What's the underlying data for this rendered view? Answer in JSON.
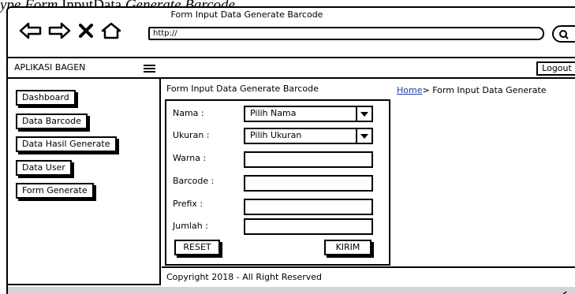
{
  "caption": {
    "prefix": "ype Form",
    "main": "InputData",
    "suffix": "Generate Barcode"
  },
  "browser": {
    "window_title": "Form Input Data Generate Barcode",
    "url": "http://",
    "nav_icons": [
      "back-arrow-icon",
      "forward-arrow-icon",
      "close-x-icon",
      "home-icon"
    ],
    "search_icon": "search-icon"
  },
  "app": {
    "title": "APLIKASI BAGEN",
    "menu_icon": "hamburger-menu-icon",
    "logout_label": "Logout"
  },
  "sidebar": {
    "items": [
      {
        "label": "Dashboard"
      },
      {
        "label": "Data Barcode"
      },
      {
        "label": "Data Hasil Generate"
      },
      {
        "label": "Data User"
      },
      {
        "label": "Form Generate"
      }
    ]
  },
  "content": {
    "header": "Form Input Data Generate Barcode",
    "breadcrumb": {
      "home": "Home",
      "separator": ">",
      "current": "Form Input Data Generate"
    }
  },
  "form": {
    "nama": {
      "label": "Nama :",
      "value": "Pilih Nama"
    },
    "ukuran": {
      "label": "Ukuran :",
      "value": "Pilih Ukuran"
    },
    "warna": {
      "label": "Warna :",
      "value": ""
    },
    "barcode": {
      "label": "Barcode :",
      "value": ""
    },
    "prefix": {
      "label": "Prefix :",
      "value": ""
    },
    "jumlah": {
      "label": "Jumlah :",
      "value": ""
    },
    "reset_label": "RESET",
    "submit_label": "KIRIM"
  },
  "footer": {
    "text": "Copyright 2018 - All Right Reserved"
  }
}
